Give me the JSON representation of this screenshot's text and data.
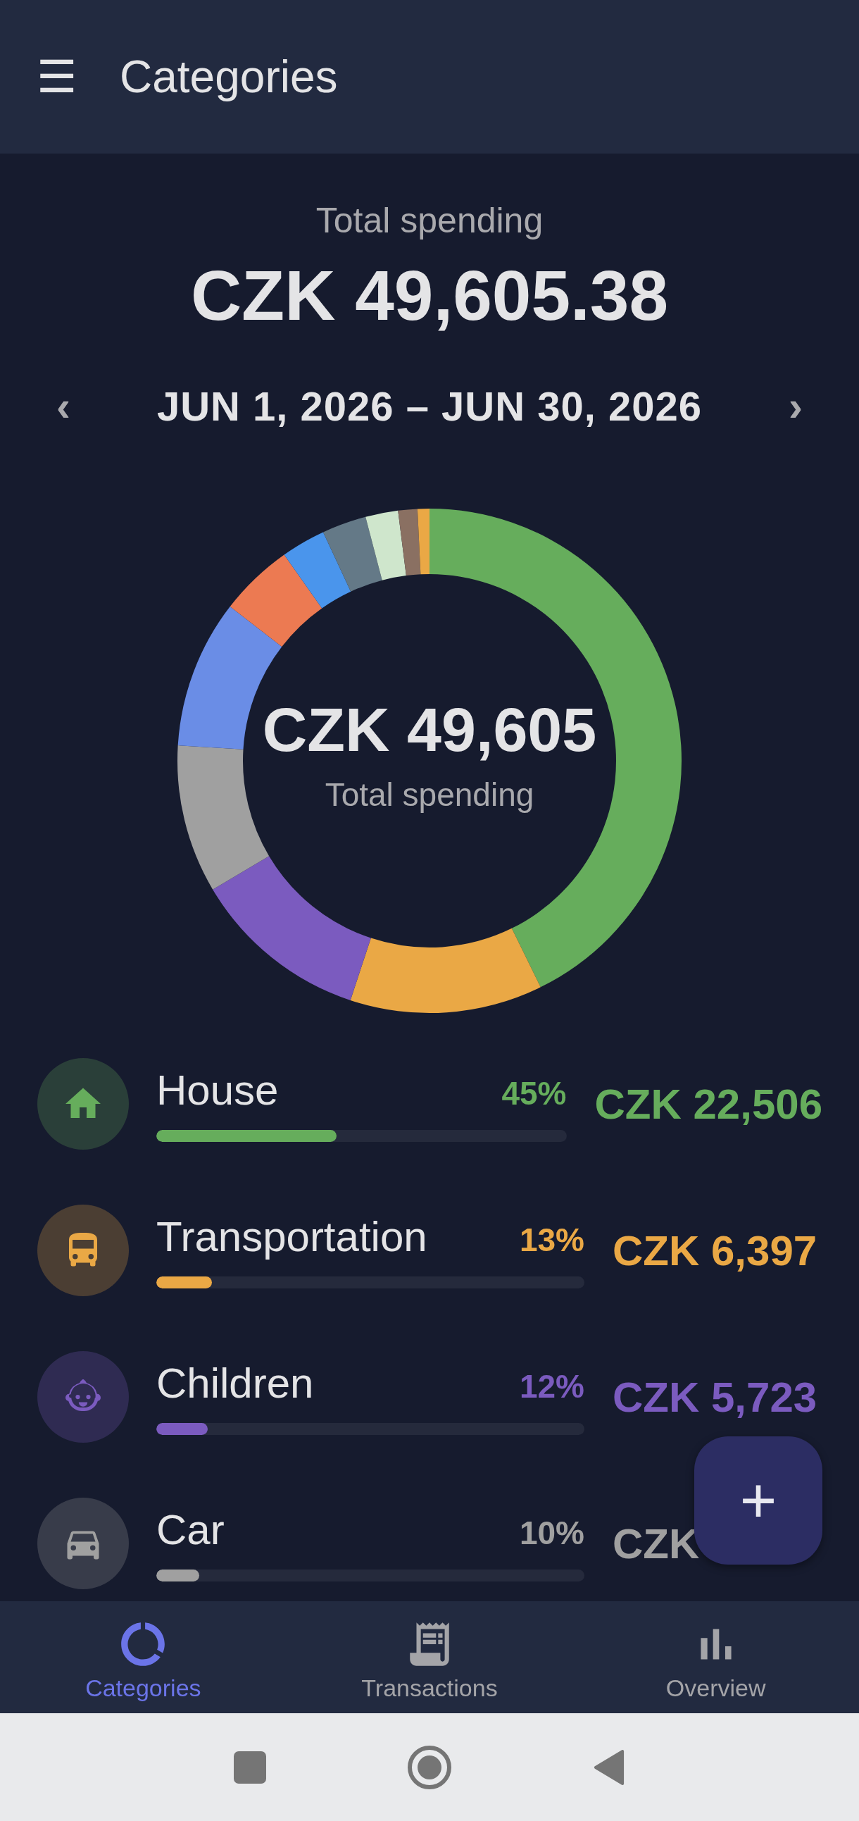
{
  "app_bar": {
    "menu_icon": "☰",
    "title": "Categories"
  },
  "summary": {
    "label": "Total spending",
    "amount": "CZK 49,605.38"
  },
  "period": {
    "prev": "‹",
    "range": "JUN 1, 2026 – JUN 30, 2026",
    "next": "›"
  },
  "donut": {
    "center_amount": "CZK 49,605",
    "center_label": "Total spending"
  },
  "categories": [
    {
      "kind": "house",
      "name": "House",
      "percent": "45%",
      "amount": "CZK 22,506",
      "level": 0.44,
      "color": "#66ad5c"
    },
    {
      "kind": "bus",
      "name": "Transportation",
      "percent": "13%",
      "amount": "CZK 6,397",
      "level": 0.13,
      "color": "#eaa845"
    },
    {
      "kind": "child",
      "name": "Children",
      "percent": "12%",
      "amount": "CZK 5,723",
      "level": 0.12,
      "color": "#7b5bbf"
    },
    {
      "kind": "car",
      "name": "Car",
      "percent": "10%",
      "amount": "CZK",
      "level": 0.1,
      "color": "#a0a0a0"
    }
  ],
  "fab": {
    "label": "+"
  },
  "bottom_nav": [
    {
      "kind": "donut",
      "label": "Categories",
      "selected": true
    },
    {
      "kind": "receipt",
      "label": "Transactions",
      "selected": false
    },
    {
      "kind": "bars",
      "label": "Overview",
      "selected": false
    }
  ]
}
